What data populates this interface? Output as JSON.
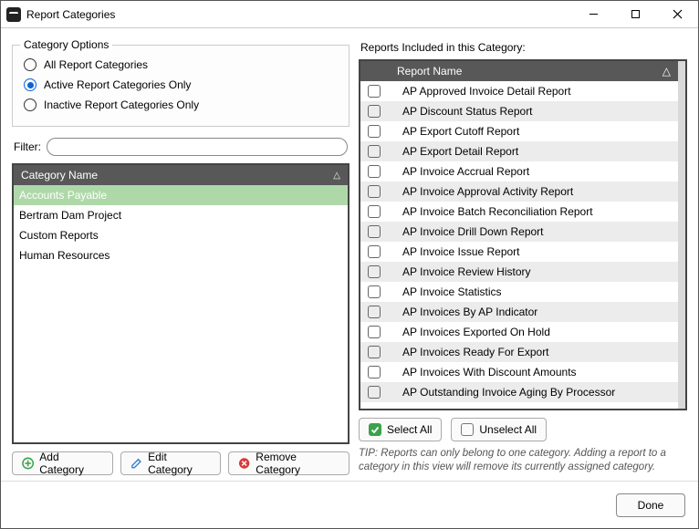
{
  "window": {
    "title": "Report Categories"
  },
  "group": {
    "title": "Category Options",
    "options": [
      {
        "label": "All Report Categories",
        "checked": false
      },
      {
        "label": "Active Report Categories Only",
        "checked": true
      },
      {
        "label": "Inactive Report Categories Only",
        "checked": false
      }
    ]
  },
  "filter": {
    "label": "Filter:",
    "value": ""
  },
  "categories": {
    "header": "Category Name",
    "items": [
      {
        "name": "Accounts Payable",
        "selected": true
      },
      {
        "name": "Bertram Dam Project",
        "selected": false
      },
      {
        "name": "Custom Reports",
        "selected": false
      },
      {
        "name": "Human Resources",
        "selected": false
      }
    ]
  },
  "catButtons": {
    "add": "Add Category",
    "edit": "Edit Category",
    "remove": "Remove Category"
  },
  "reportsLabel": "Reports Included in this Category:",
  "reports": {
    "header": "Report Name",
    "items": [
      "AP Approved Invoice Detail Report",
      "AP Discount Status Report",
      "AP Export Cutoff Report",
      "AP Export Detail Report",
      "AP Invoice Accrual Report",
      "AP Invoice Approval Activity Report",
      "AP Invoice Batch Reconciliation Report",
      "AP Invoice Drill Down Report",
      "AP Invoice Issue Report",
      "AP Invoice Review History",
      "AP Invoice Statistics",
      "AP Invoices By AP Indicator",
      "AP Invoices Exported On Hold",
      "AP Invoices Ready For Export",
      "AP Invoices With Discount Amounts",
      "AP Outstanding Invoice Aging By Processor"
    ]
  },
  "selectAll": "Select All",
  "unselectAll": "Unselect All",
  "tip": "TIP:  Reports can only belong to one category.  Adding a report to a category in this view will remove its currently assigned category.",
  "done": "Done"
}
